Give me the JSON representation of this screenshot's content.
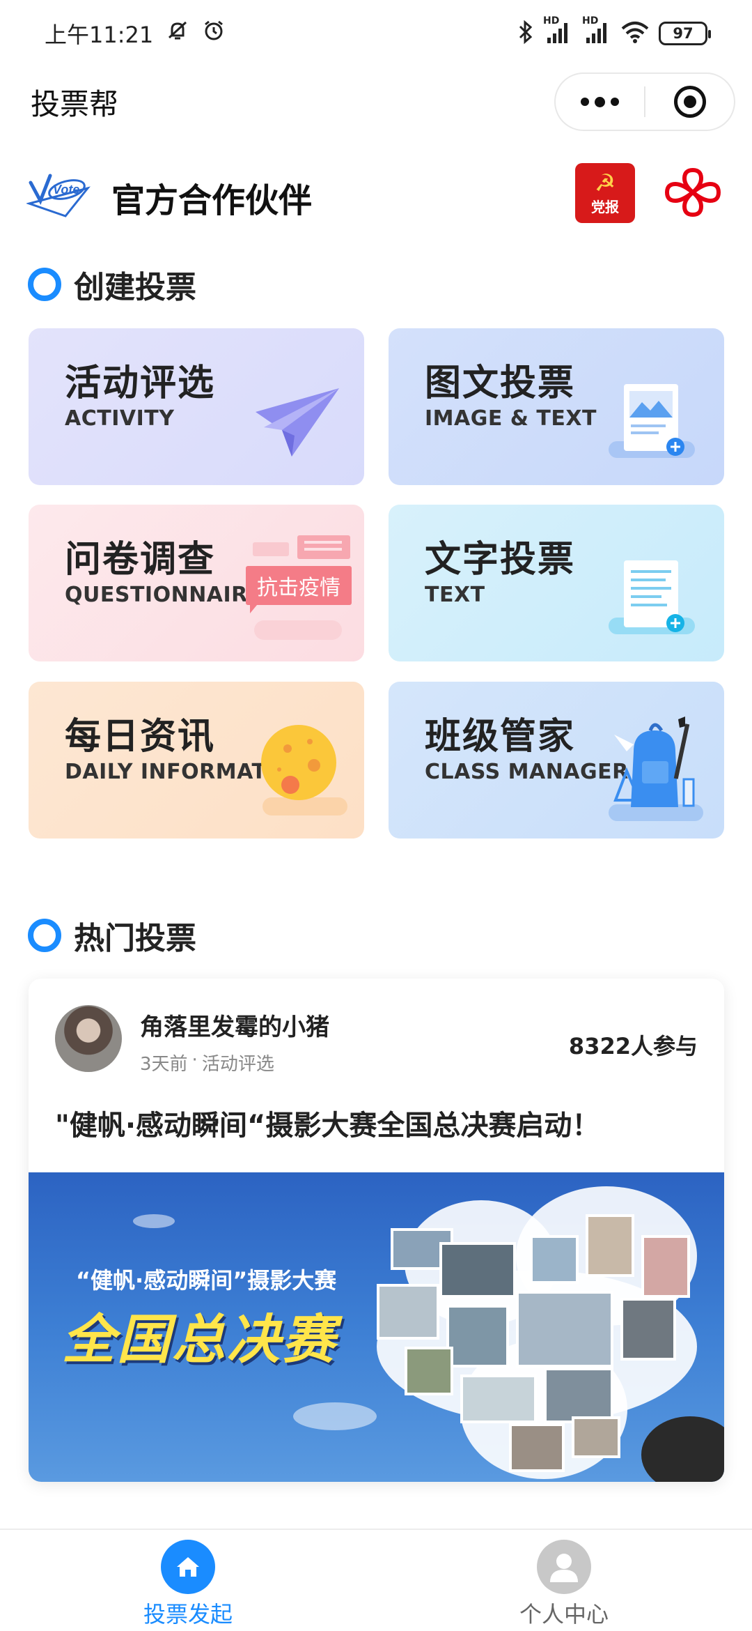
{
  "status_bar": {
    "time": "上午11:21",
    "battery": "97",
    "icons": [
      "mute-icon",
      "alarm-icon",
      "bluetooth-icon",
      "signal-icon",
      "signal-icon",
      "wifi-icon",
      "battery-icon"
    ],
    "hd1": "HD",
    "hd2": "HD"
  },
  "header": {
    "title": "投票帮"
  },
  "partners": {
    "title": "官方合作伙伴",
    "vote_logo_text": "Vote",
    "party_logo_text": "党报"
  },
  "create_section": {
    "title": "创建投票",
    "cards": [
      {
        "title": "活动评选",
        "subtitle": "ACTIVITY",
        "color": "#dcdffb"
      },
      {
        "title": "图文投票",
        "subtitle": "IMAGE & TEXT",
        "color": "#cddcfa"
      },
      {
        "title": "问卷调查",
        "subtitle": "QUESTIONNAIRE",
        "color": "#fce3e7"
      },
      {
        "title": "文字投票",
        "subtitle": "TEXT",
        "color": "#cdeefb"
      },
      {
        "title": "每日资讯",
        "subtitle": "DAILY INFORMATIO",
        "color": "#fde3cc"
      },
      {
        "title": "班级管家",
        "subtitle": "CLASS MANAGER",
        "color": "#cfe2fa"
      }
    ],
    "questionnaire_tag": "抗击疫情"
  },
  "hot_section": {
    "title": "热门投票",
    "item": {
      "author": "角落里发霉的小猪",
      "time_ago": "3天前",
      "separator": "·",
      "category": "活动评选",
      "participants": "8322人参与",
      "title": "\"健帆·感动瞬间“摄影大赛全国总决赛启动！",
      "banner_subtitle": "“健帆·感动瞬间”摄影大赛",
      "banner_title": "全国总决赛"
    }
  },
  "bottom_nav": {
    "items": [
      {
        "label": "投票发起",
        "icon": "home-icon",
        "active": true
      },
      {
        "label": "个人中心",
        "icon": "user-icon",
        "active": false
      }
    ]
  },
  "colors": {
    "accent": "#1a8cff",
    "party_red": "#d71a1a",
    "unicom_red": "#e60012"
  }
}
